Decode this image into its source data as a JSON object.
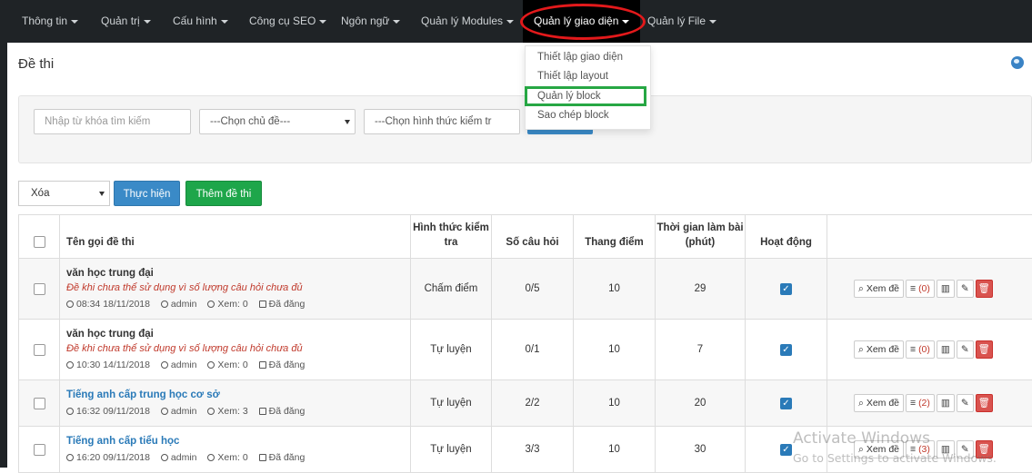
{
  "nav": {
    "items": [
      "Thông tin",
      "Quản trị",
      "Cấu hình",
      "Công cụ SEO",
      "Ngôn ngữ",
      "Quản lý Modules",
      "Quản lý giao diện",
      "Quản lý File"
    ],
    "active_index": 6
  },
  "dropdown": {
    "items": [
      "Thiết lập giao diện",
      "Thiết lập layout",
      "Quản lý block",
      "Sao chép block"
    ],
    "highlighted_index": 2
  },
  "page": {
    "title": "Đề thi"
  },
  "filters": {
    "keyword_placeholder": "Nhập từ khóa tìm kiếm",
    "topic_select": "---Chọn chủ đề---",
    "type_select": "---Chọn hình thức kiểm tr"
  },
  "bulk": {
    "action_select": "Xóa",
    "execute_button": "Thực hiện",
    "add_button": "Thêm đề thi"
  },
  "table": {
    "headers": {
      "name": "Tên gọi đề thi",
      "type": "Hình thức kiểm tra",
      "questions": "Số câu hỏi",
      "scale": "Thang điểm",
      "duration": "Thời gian làm bài (phút)",
      "active": "Hoạt động"
    },
    "rows": [
      {
        "name": "văn học trung đại",
        "warning": "Đề khi chưa thể sử dụng vì số lượng câu hỏi chưa đủ",
        "time": "08:34 18/11/2018",
        "author": "admin",
        "views": "Xem: 0",
        "status": "Đã đăng",
        "type": "Chấm điểm",
        "questions": "0/5",
        "scale": "10",
        "duration": "29",
        "active": true,
        "view_label": "Xem đề",
        "count": "(0)"
      },
      {
        "name": "văn học trung đại",
        "warning": "Đề khi chưa thể sử dụng vì số lượng câu hỏi chưa đủ",
        "time": "10:30 14/11/2018",
        "author": "admin",
        "views": "Xem: 0",
        "status": "Đã đăng",
        "type": "Tự luyện",
        "questions": "0/1",
        "scale": "10",
        "duration": "7",
        "active": true,
        "view_label": "Xem đề",
        "count": "(0)"
      },
      {
        "name": "Tiếng anh cấp trung học cơ sở",
        "warning": "",
        "time": "16:32 09/11/2018",
        "author": "admin",
        "views": "Xem: 3",
        "status": "Đã đăng",
        "type": "Tự luyện",
        "questions": "2/2",
        "scale": "10",
        "duration": "20",
        "active": true,
        "view_label": "Xem đề",
        "count": "(2)"
      },
      {
        "name": "Tiếng anh cấp tiểu học",
        "warning": "",
        "time": "16:20 09/11/2018",
        "author": "admin",
        "views": "Xem: 0",
        "status": "Đã đăng",
        "type": "Tự luyện",
        "questions": "3/3",
        "scale": "10",
        "duration": "30",
        "active": true,
        "view_label": "Xem đề",
        "count": "(3)"
      }
    ]
  },
  "watermark": {
    "line1": "Activate Windows",
    "line2": "Go to Settings to activate Windows."
  },
  "colors": {
    "nav_bg": "#1f2326",
    "primary": "#3a8ac7",
    "success": "#1ea64a",
    "danger": "#d9534f",
    "link": "#2a7ab8",
    "annotation_red": "#e3191b",
    "annotation_green": "#27a744"
  }
}
